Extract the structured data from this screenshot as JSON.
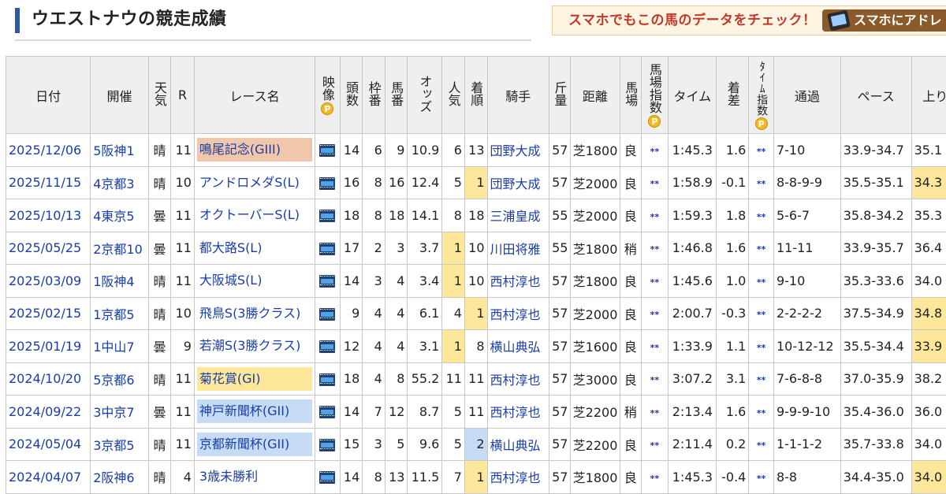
{
  "page_title": "ウエストナウの競走成績",
  "promo": {
    "text": "スマホでもこの馬のデータをチェック！",
    "button_label": "スマホにアドレ"
  },
  "headers": {
    "date": "日付",
    "venue": "開催",
    "weather": "天気",
    "race_no": "R",
    "race_name": "レース名",
    "video": "映像",
    "field_size": "頭数",
    "frame": "枠番",
    "horse_no": "馬番",
    "odds": "オッズ",
    "popularity": "人気",
    "finish": "着順",
    "jockey": "騎手",
    "weight": "斤量",
    "distance": "距離",
    "track": "馬場",
    "track_index": "馬場指数",
    "time": "タイム",
    "margin": "着差",
    "time_index": "ﾀｲﾑ指数",
    "passing": "通過",
    "pace": "ペース",
    "last3f": "上り",
    "p_badge": "P"
  },
  "index_mark": "**",
  "rows": [
    {
      "date": "2025/12/06",
      "venue": "5阪神1",
      "weather": "晴",
      "race_no": "11",
      "race_name": "鳴尾記念(GIII)",
      "field_size": "14",
      "frame": "6",
      "horse_no": "9",
      "odds": "10.9",
      "popularity": "6",
      "finish": "13",
      "jockey": "団野大成",
      "weight": "57",
      "distance": "芝1800",
      "track": "良",
      "time": "1:45.3",
      "margin": "1.6",
      "passing": "7-10",
      "pace": "33.9-34.7",
      "last3f": "35.1"
    },
    {
      "date": "2025/11/15",
      "venue": "4京都3",
      "weather": "晴",
      "race_no": "10",
      "race_name": "アンドロメダS(L)",
      "field_size": "16",
      "frame": "8",
      "horse_no": "16",
      "odds": "12.4",
      "popularity": "5",
      "finish": "1",
      "jockey": "団野大成",
      "weight": "57",
      "distance": "芝2000",
      "track": "良",
      "time": "1:58.9",
      "margin": "-0.1",
      "passing": "8-8-9-9",
      "pace": "35.5-35.1",
      "last3f": "34.3"
    },
    {
      "date": "2025/10/13",
      "venue": "4東京5",
      "weather": "曇",
      "race_no": "11",
      "race_name": "オクトーバーS(L)",
      "field_size": "18",
      "frame": "8",
      "horse_no": "18",
      "odds": "14.1",
      "popularity": "8",
      "finish": "18",
      "jockey": "三浦皇成",
      "weight": "55",
      "distance": "芝2000",
      "track": "良",
      "time": "1:59.3",
      "margin": "1.8",
      "passing": "5-6-7",
      "pace": "35.8-34.2",
      "last3f": "35.3"
    },
    {
      "date": "2025/05/25",
      "venue": "2京都10",
      "weather": "曇",
      "race_no": "11",
      "race_name": "都大路S(L)",
      "field_size": "17",
      "frame": "2",
      "horse_no": "3",
      "odds": "3.7",
      "popularity": "1",
      "finish": "10",
      "jockey": "川田将雅",
      "weight": "55",
      "distance": "芝1800",
      "track": "稍",
      "time": "1:46.8",
      "margin": "1.6",
      "passing": "11-11",
      "pace": "33.9-35.7",
      "last3f": "36.4"
    },
    {
      "date": "2025/03/09",
      "venue": "1阪神4",
      "weather": "晴",
      "race_no": "11",
      "race_name": "大阪城S(L)",
      "field_size": "14",
      "frame": "3",
      "horse_no": "4",
      "odds": "3.4",
      "popularity": "1",
      "finish": "10",
      "jockey": "西村淳也",
      "weight": "57",
      "distance": "芝1800",
      "track": "良",
      "time": "1:45.6",
      "margin": "1.0",
      "passing": "9-10",
      "pace": "35.3-33.6",
      "last3f": "34.0"
    },
    {
      "date": "2025/02/15",
      "venue": "1京都5",
      "weather": "晴",
      "race_no": "10",
      "race_name": "飛鳥S(3勝クラス)",
      "field_size": "9",
      "frame": "4",
      "horse_no": "4",
      "odds": "6.1",
      "popularity": "4",
      "finish": "1",
      "jockey": "西村淳也",
      "weight": "57",
      "distance": "芝2000",
      "track": "良",
      "time": "2:00.7",
      "margin": "-0.3",
      "passing": "2-2-2-2",
      "pace": "37.5-34.9",
      "last3f": "34.8"
    },
    {
      "date": "2025/01/19",
      "venue": "1中山7",
      "weather": "曇",
      "race_no": "9",
      "race_name": "若潮S(3勝クラス)",
      "field_size": "12",
      "frame": "4",
      "horse_no": "4",
      "odds": "3.1",
      "popularity": "1",
      "finish": "8",
      "jockey": "横山典弘",
      "weight": "57",
      "distance": "芝1600",
      "track": "良",
      "time": "1:33.9",
      "margin": "1.1",
      "passing": "10-12-12",
      "pace": "35.5-34.4",
      "last3f": "33.9"
    },
    {
      "date": "2024/10/20",
      "venue": "5京都6",
      "weather": "晴",
      "race_no": "11",
      "race_name": "菊花賞(GI)",
      "field_size": "18",
      "frame": "4",
      "horse_no": "8",
      "odds": "55.2",
      "popularity": "11",
      "finish": "11",
      "jockey": "西村淳也",
      "weight": "57",
      "distance": "芝3000",
      "track": "良",
      "time": "3:07.2",
      "margin": "3.1",
      "passing": "7-6-8-8",
      "pace": "37.0-35.9",
      "last3f": "38.2"
    },
    {
      "date": "2024/09/22",
      "venue": "3中京7",
      "weather": "曇",
      "race_no": "11",
      "race_name": "神戸新聞杯(GII)",
      "field_size": "14",
      "frame": "7",
      "horse_no": "12",
      "odds": "8.7",
      "popularity": "5",
      "finish": "11",
      "jockey": "西村淳也",
      "weight": "57",
      "distance": "芝2200",
      "track": "稍",
      "time": "2:13.4",
      "margin": "1.6",
      "passing": "9-9-9-10",
      "pace": "35.4-36.0",
      "last3f": "36.0"
    },
    {
      "date": "2024/05/04",
      "venue": "3京都5",
      "weather": "晴",
      "race_no": "11",
      "race_name": "京都新聞杯(GII)",
      "field_size": "15",
      "frame": "3",
      "horse_no": "5",
      "odds": "9.6",
      "popularity": "5",
      "finish": "2",
      "jockey": "横山典弘",
      "weight": "57",
      "distance": "芝2200",
      "track": "良",
      "time": "2:11.4",
      "margin": "0.2",
      "passing": "1-1-1-2",
      "pace": "35.7-33.8",
      "last3f": "34.0"
    },
    {
      "date": "2024/04/07",
      "venue": "2阪神6",
      "weather": "晴",
      "race_no": "4",
      "race_name": "3歳未勝利",
      "field_size": "14",
      "frame": "8",
      "horse_no": "13",
      "odds": "11.5",
      "popularity": "7",
      "finish": "1",
      "jockey": "西村淳也",
      "weight": "57",
      "distance": "芝1800",
      "track": "良",
      "time": "1:45.3",
      "margin": "-0.4",
      "passing": "8-8",
      "pace": "34.4-35.0",
      "last3f": "34.0"
    }
  ]
}
